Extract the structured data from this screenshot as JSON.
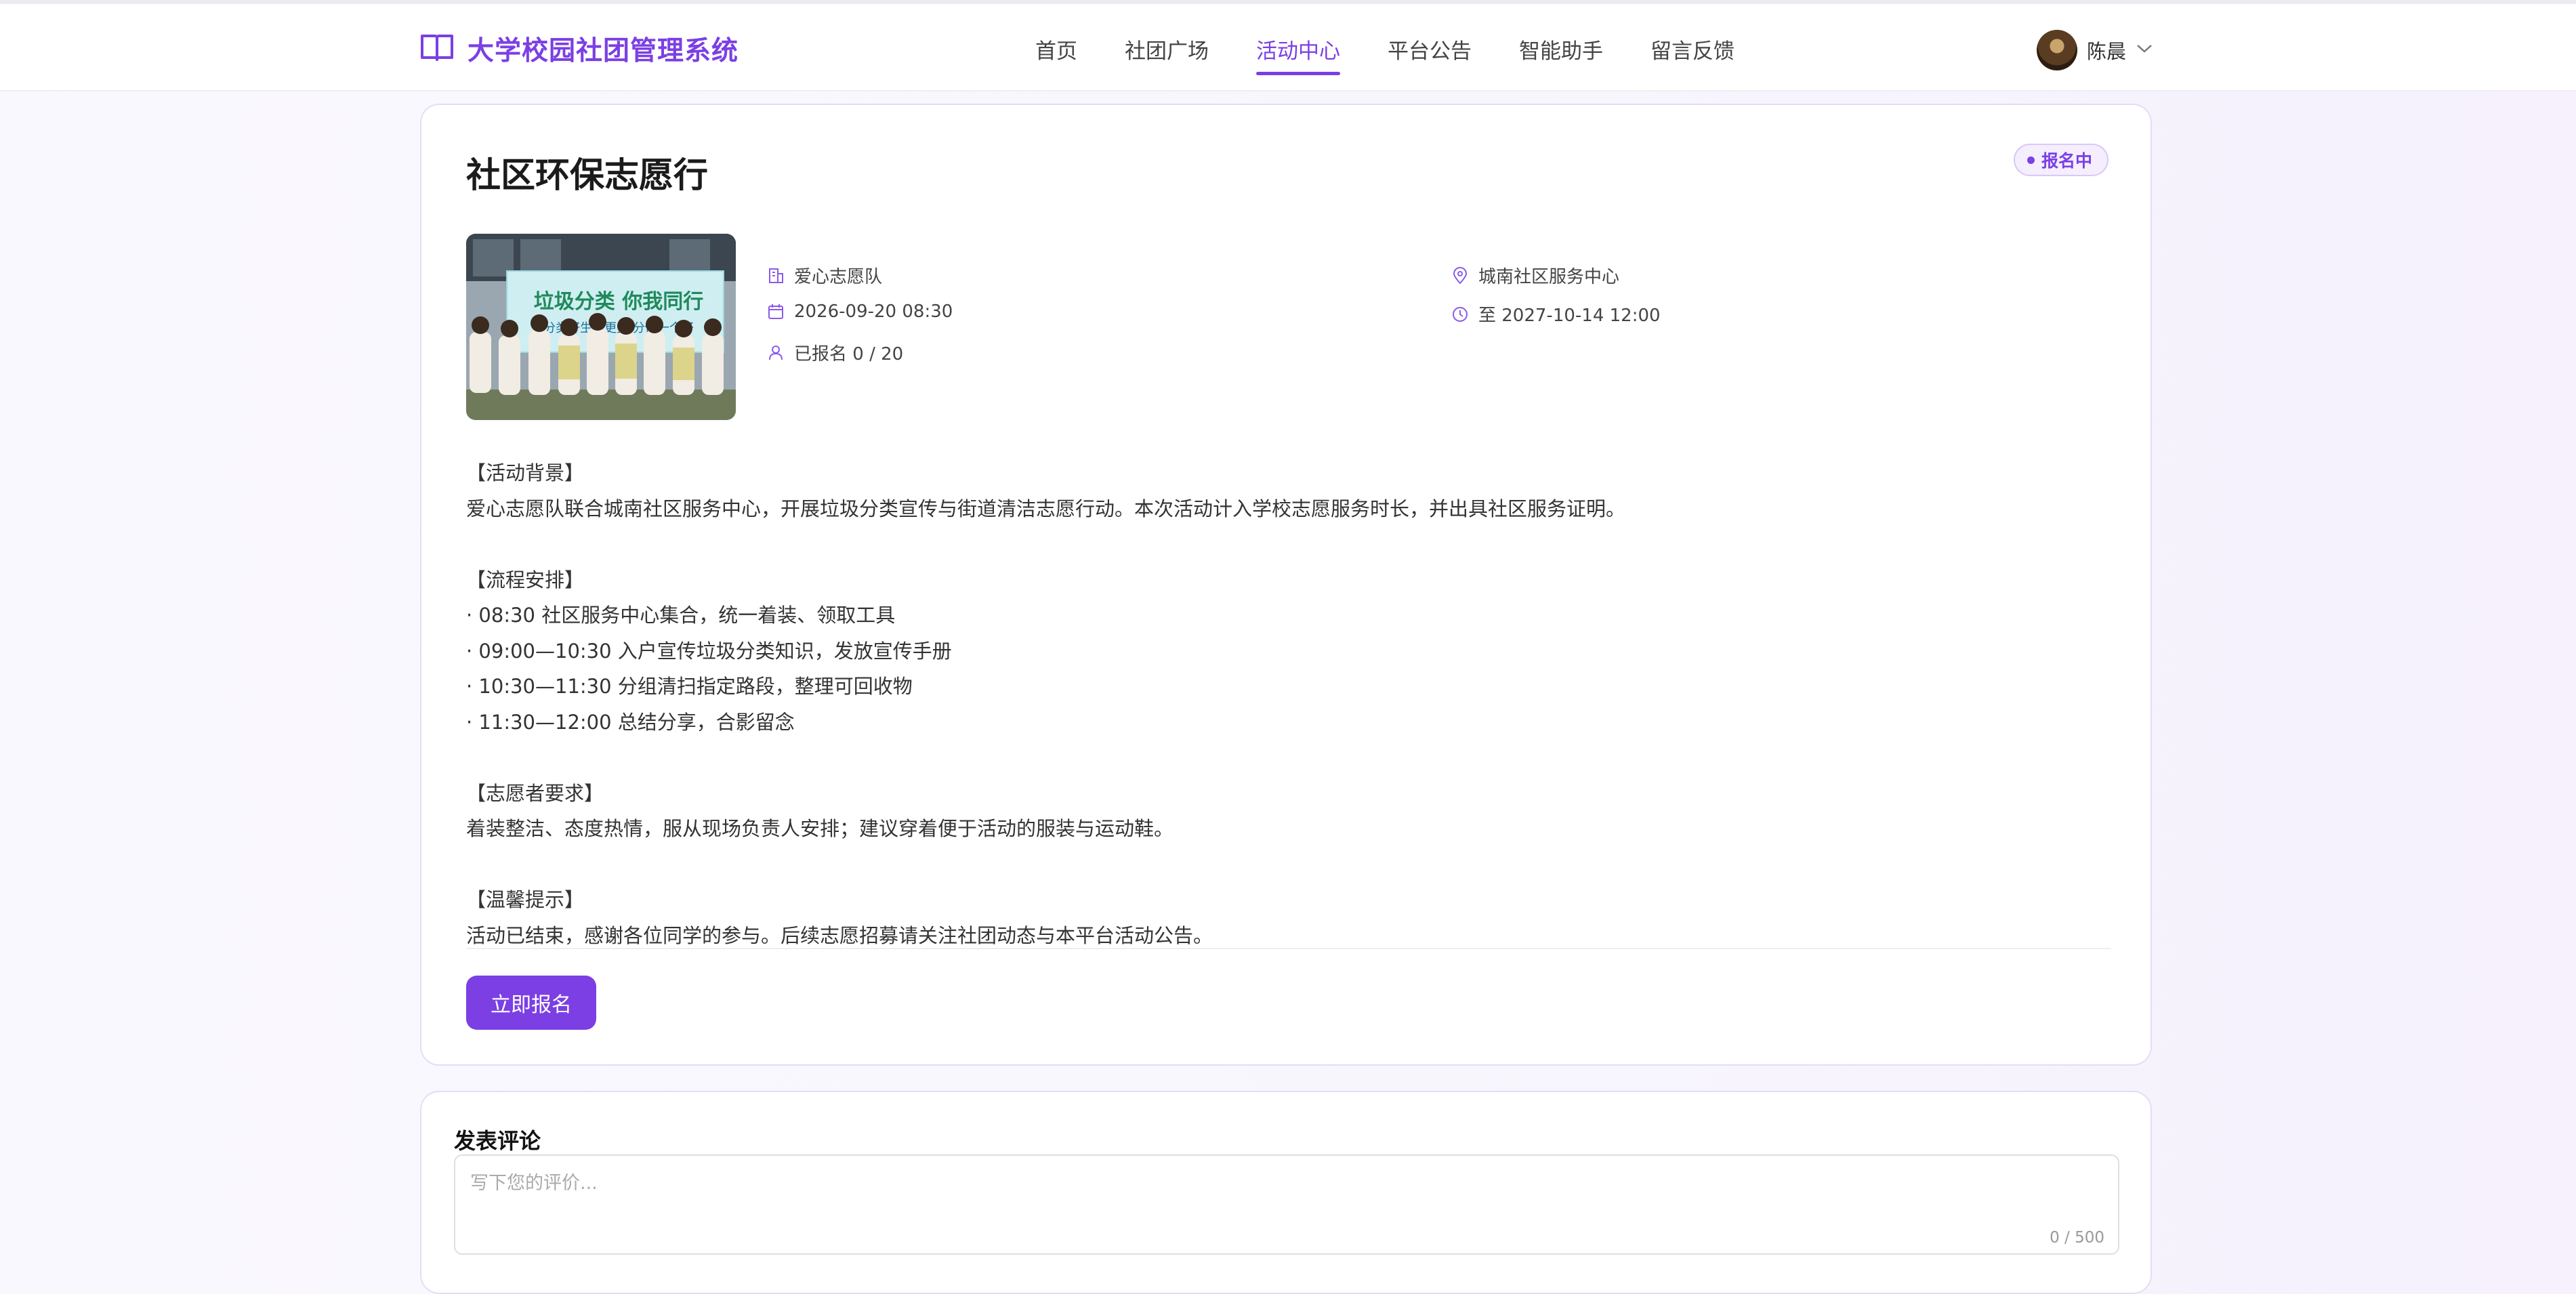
{
  "header": {
    "brand_title": "大学校园社团管理系统",
    "nav": [
      "首页",
      "社团广场",
      "活动中心",
      "平台公告",
      "智能助手",
      "留言反馈"
    ],
    "active_nav": "活动中心",
    "user_name": "陈晨"
  },
  "activity": {
    "title": "社区环保志愿行",
    "status": "报名中",
    "club": "爱心志愿队",
    "start_time": "2026-09-20 08:30",
    "enrolled": "已报名 0 / 20",
    "location": "城南社区服务中心",
    "end_time": "至 2027-10-14 12:00",
    "description": [
      "【活动背景】",
      "爱心志愿队联合城南社区服务中心，开展垃圾分类宣传与街道清洁志愿行动。本次活动计入学校志愿服务时长，并出具社区服务证明。",
      "",
      "【流程安排】",
      "· 08:30 社区服务中心集合，统一着装、领取工具",
      "· 09:00—10:30 入户宣传垃圾分类知识，发放宣传手册",
      "· 10:30—11:30 分组清扫指定路段，整理可回收物",
      "· 11:30—12:00 总结分享，合影留念",
      "",
      "【志愿者要求】",
      "着装整洁、态度热情，服从现场负责人安排；建议穿着便于活动的服装与运动鞋。",
      "",
      "【温馨提示】",
      "活动已结束，感谢各位同学的参与。后续志愿招募请关注社团动态与本平台活动公告。"
    ],
    "register_button": "立即报名",
    "photo_banner_line1": "垃圾分类 你我同行",
    "photo_banner_line2": "分类好生活更美 分你一个好"
  },
  "comment": {
    "title": "发表评论",
    "placeholder": "写下您的评价...",
    "value": "",
    "counter": "0 / 500"
  },
  "colors": {
    "accent": "#7b3fe4",
    "badge_bg": "#f4eeff"
  }
}
